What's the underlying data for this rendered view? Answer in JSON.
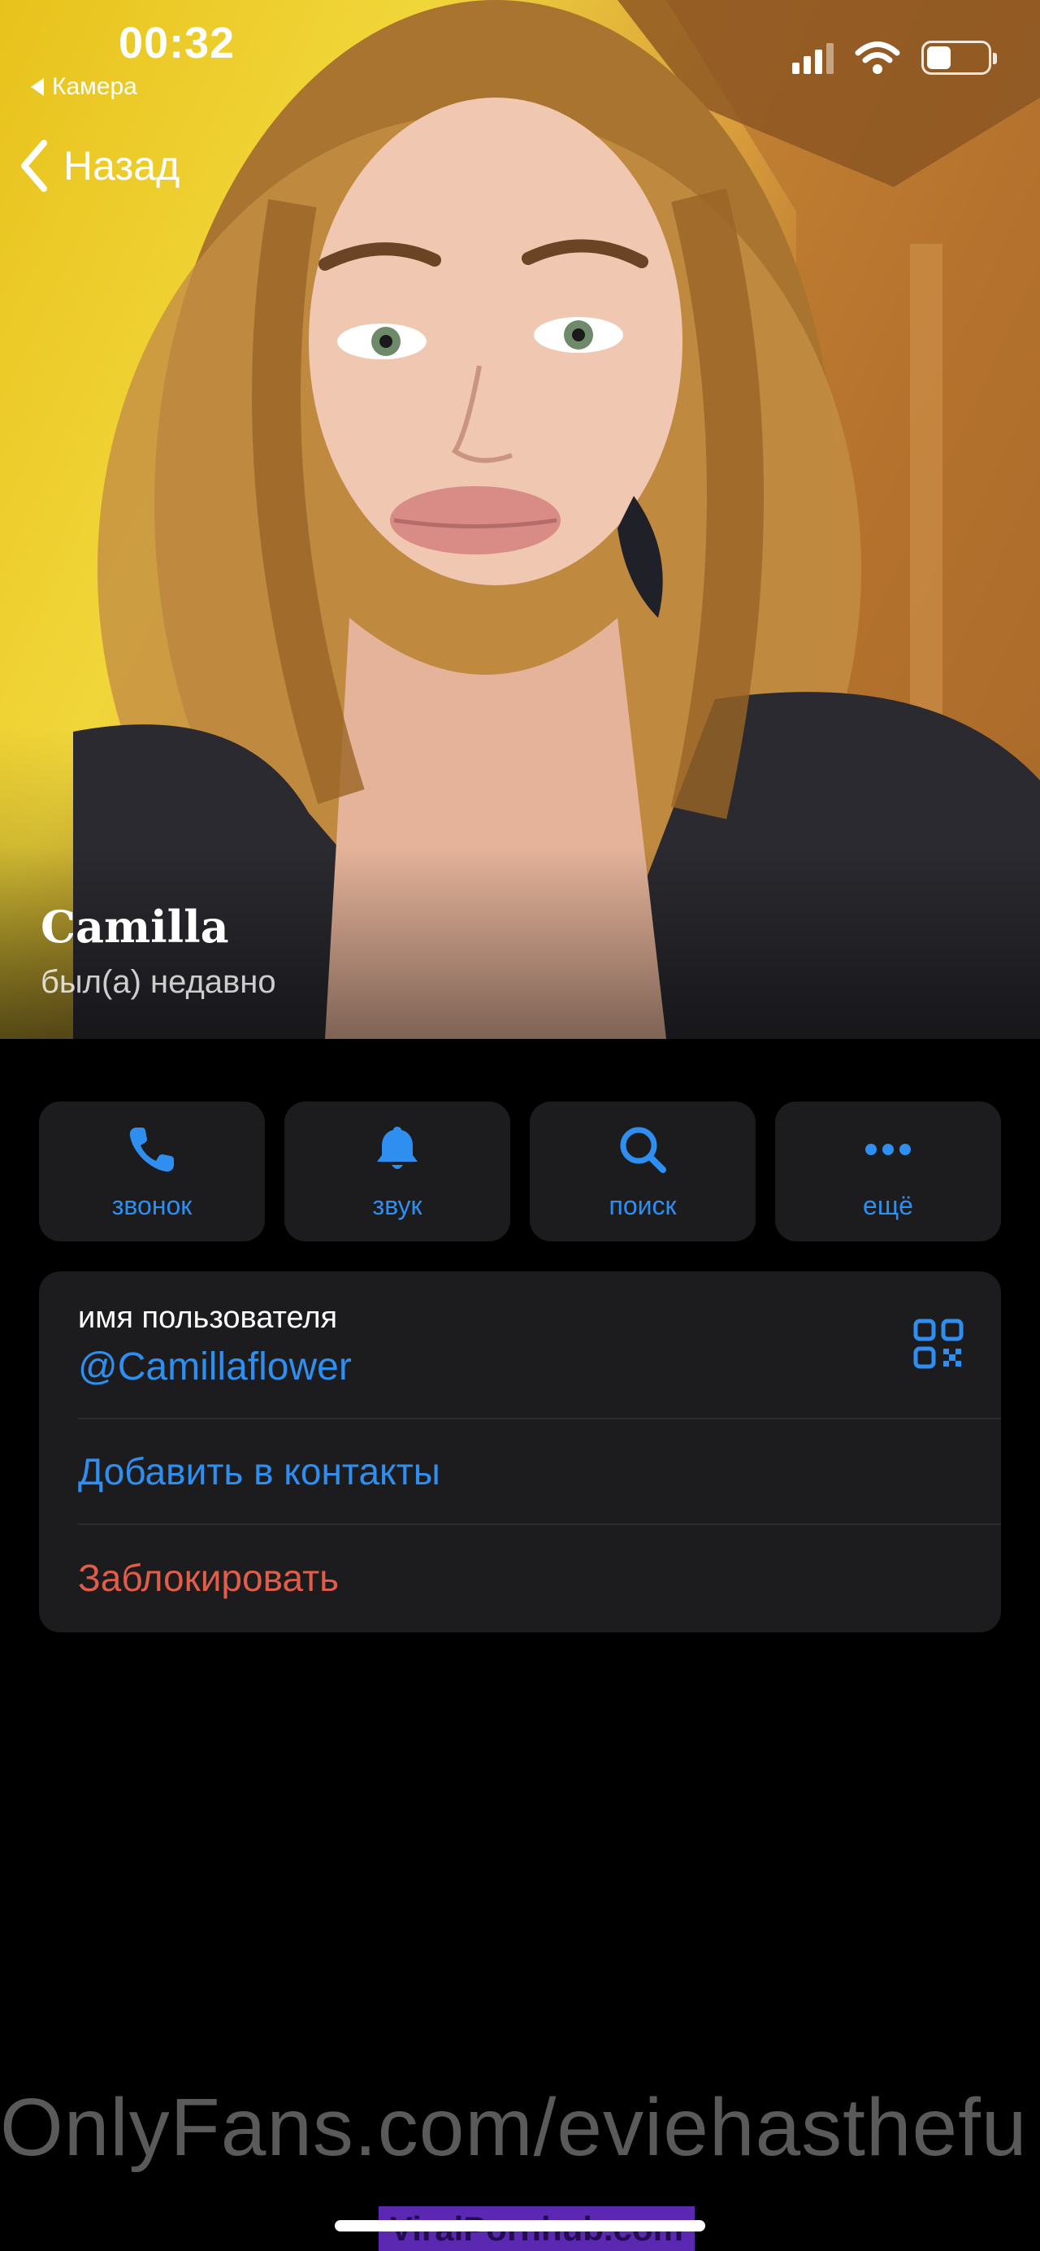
{
  "status_bar": {
    "time": "00:32",
    "back_app": "Камера",
    "battery_fraction": 0.4
  },
  "nav": {
    "back_label": "Назад"
  },
  "profile": {
    "name": "Camilla",
    "last_seen": "был(а) недавно"
  },
  "actions": [
    {
      "label": "звонок",
      "icon": "phone-icon"
    },
    {
      "label": "звук",
      "icon": "bell-icon"
    },
    {
      "label": "поиск",
      "icon": "search-icon"
    },
    {
      "label": "ещё",
      "icon": "more-icon"
    }
  ],
  "info": {
    "username_caption": "имя пользователя",
    "username": "@Camillaflower",
    "add_contact": "Добавить в контакты",
    "block": "Заблокировать"
  },
  "watermark": {
    "text": "OnlyFans.com/eviehasthefu",
    "small": "ViralPornhub.com"
  },
  "colors": {
    "accent": "#2f8ff0",
    "danger": "#e25c4a",
    "card": "#1c1c1e",
    "background": "#000000"
  }
}
